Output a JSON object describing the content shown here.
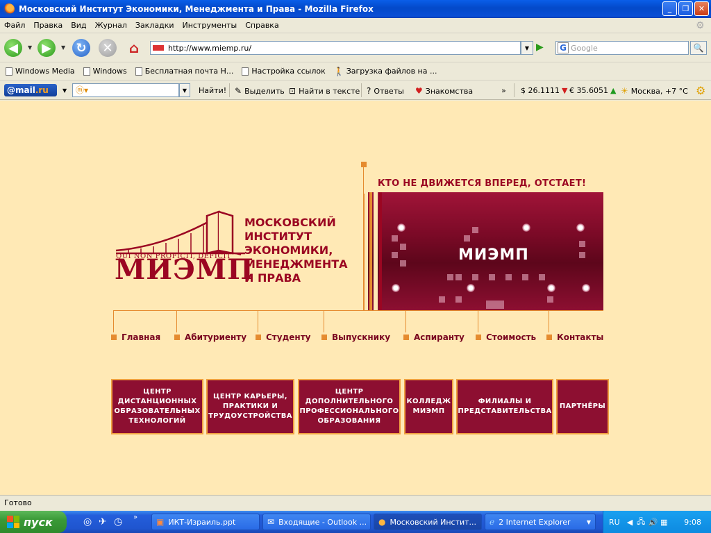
{
  "window": {
    "title": "Московский Институт Экономики, Менеджмента и Права - Mozilla Firefox"
  },
  "menu": [
    "Файл",
    "Правка",
    "Вид",
    "Журнал",
    "Закладки",
    "Инструменты",
    "Справка"
  ],
  "nav": {
    "url": "http://www.miemp.ru/",
    "search_placeholder": "Google"
  },
  "bookmarks": [
    "Windows Media",
    "Windows",
    "Бесплатная почта Н...",
    "Настройка ссылок",
    "Загрузка файлов на ..."
  ],
  "mailru": {
    "logo_at": "@mail",
    "logo_ru": ".ru",
    "find": "Найти!",
    "highlight": "Выделить",
    "find_in_text": "Найти в тексте",
    "answers": "Ответы",
    "dating": "Знакомства",
    "more": "»",
    "usd": "$ 26.1111",
    "eur": "€ 35.6051",
    "weather": "Москва, +7 °C"
  },
  "site": {
    "slogan": "КТО НЕ ДВИЖЕТСЯ  ВПЕРЕД, ОТСТАЕТ!",
    "banner_title": "МИЭМП",
    "motto": "QUI NON PROFICIT, DEFICIT",
    "logo_name": "МИЭМП",
    "institute": [
      "МОСКОВСКИЙ",
      "ИНСТИТУТ",
      "ЭКОНОМИКИ,",
      "МЕНЕДЖМЕНТА",
      "И ПРАВА"
    ],
    "nav": [
      "Главная",
      "Абитуриенту",
      "Студенту",
      "Выпускнику",
      "Аспиранту",
      "Стоимость",
      "Контакты"
    ],
    "boxes": [
      "ЦЕНТР ДИСТАНЦИОННЫХ ОБРАЗОВАТЕЛЬНЫХ ТЕХНОЛОГИЙ",
      "ЦЕНТР КАРЬЕРЫ, ПРАКТИКИ И ТРУДОУСТРОЙСТВА",
      "ЦЕНТР ДОПОЛНИТЕЛЬНОГО ПРОФЕССИОНАЛЬНОГО ОБРАЗОВАНИЯ",
      "КОЛЛЕДЖ МИЭМП",
      "ФИЛИАЛЫ И ПРЕДСТАВИТЕЛЬСТВА",
      "ПАРТНЁРЫ"
    ]
  },
  "status": "Готово",
  "taskbar": {
    "start": "пуск",
    "tasks": [
      "ИКТ-Израиль.ppt",
      "Входящие - Outlook ...",
      "Московский Инстит...",
      "2 Internet Explorer"
    ],
    "lang": "RU",
    "clock": "9:08"
  }
}
